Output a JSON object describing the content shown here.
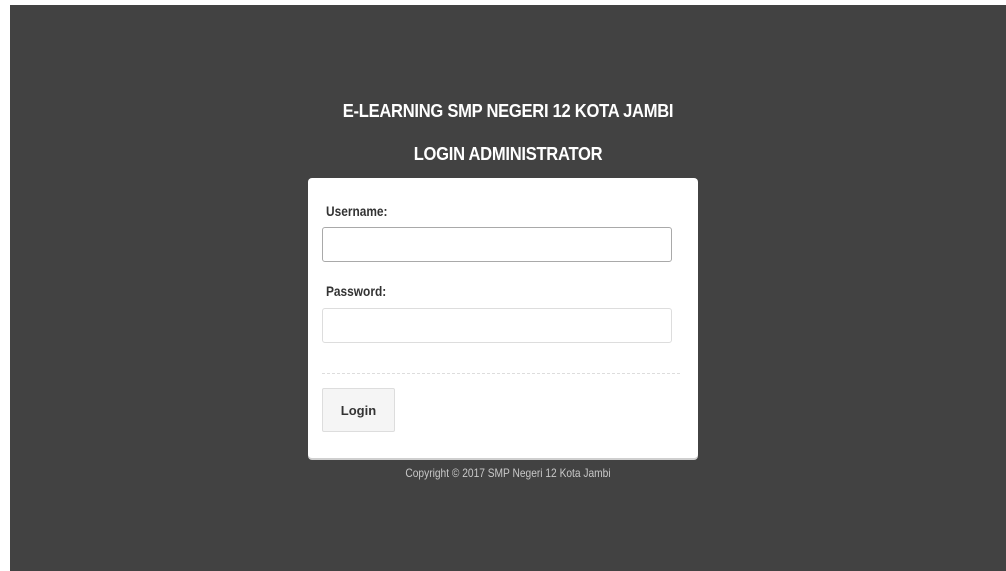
{
  "header": {
    "app_title": "E-LEARNING SMP NEGERI 12 KOTA JAMBI",
    "page_title": "LOGIN ADMINISTRATOR"
  },
  "form": {
    "username_label": "Username:",
    "username_value": "",
    "password_label": "Password:",
    "password_value": "",
    "login_label": "Login"
  },
  "footer": {
    "copyright": "Copyright © 2017 SMP Negeri 12 Kota Jambi"
  },
  "colors": {
    "background": "#424242",
    "card": "#ffffff",
    "title_text": "#ffffff",
    "footer_text": "#c8c8c8"
  }
}
